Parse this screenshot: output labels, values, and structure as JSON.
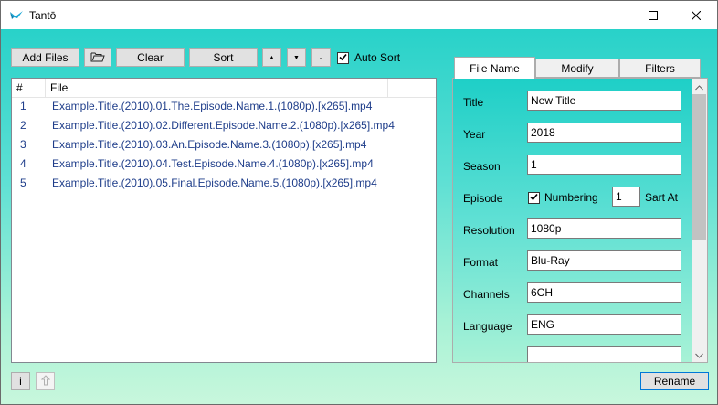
{
  "app": {
    "title": "Tantō"
  },
  "window_controls": {
    "minimize": "minimize-icon",
    "maximize": "maximize-icon",
    "close": "close-icon"
  },
  "toolbar": {
    "add_files": "Add Files",
    "open_folder_icon": "folder-icon",
    "clear": "Clear",
    "sort": "Sort",
    "move_up": "▲",
    "move_down": "▼",
    "remove": "-",
    "auto_sort_label": "Auto Sort",
    "auto_sort_checked": true
  },
  "file_list": {
    "columns": [
      "#",
      "File"
    ],
    "rows": [
      {
        "num": "1",
        "file": "Example.Title.(2010).01.The.Episode.Name.1.(1080p).[x265].mp4"
      },
      {
        "num": "2",
        "file": "Example.Title.(2010).02.Different.Episode.Name.2.(1080p).[x265].mp4"
      },
      {
        "num": "3",
        "file": "Example.Title.(2010).03.An.Episode.Name.3.(1080p).[x265].mp4"
      },
      {
        "num": "4",
        "file": "Example.Title.(2010).04.Test.Episode.Name.4.(1080p).[x265].mp4"
      },
      {
        "num": "5",
        "file": "Example.Title.(2010).05.Final.Episode.Name.5.(1080p).[x265].mp4"
      }
    ]
  },
  "tabs": [
    {
      "label": "File Name",
      "active": true
    },
    {
      "label": "Modify",
      "active": false
    },
    {
      "label": "Filters",
      "active": false
    }
  ],
  "form": {
    "title": {
      "label": "Title",
      "value": "New Title"
    },
    "year": {
      "label": "Year",
      "value": "2018"
    },
    "season": {
      "label": "Season",
      "value": "1"
    },
    "episode": {
      "label": "Episode",
      "numbering_label": "Numbering",
      "numbering_checked": true,
      "start_value": "1",
      "sart_at_label": "Sart At"
    },
    "resolution": {
      "label": "Resolution",
      "value": "1080p"
    },
    "format": {
      "label": "Format",
      "value": "Blu-Ray"
    },
    "channels": {
      "label": "Channels",
      "value": "6CH"
    },
    "language": {
      "label": "Language",
      "value": "ENG"
    }
  },
  "bottom": {
    "info_button": "i",
    "upload_icon": "upload-arrow-icon",
    "rename": "Rename"
  },
  "colors": {
    "background_top": "#1ecfc7",
    "background_bottom": "#c8f7dc",
    "list_text": "#1e3d8a",
    "focus_border": "#0078d7"
  }
}
